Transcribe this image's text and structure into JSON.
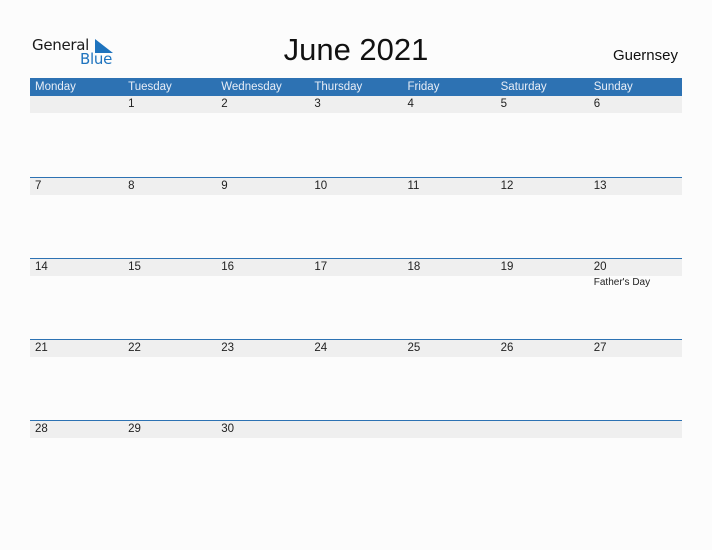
{
  "brand": {
    "line1": "General",
    "line2": "Blue",
    "color": "#1e73be"
  },
  "title": "June 2021",
  "country": "Guernsey",
  "accent_color": "#2d72b3",
  "weekdays": [
    "Monday",
    "Tuesday",
    "Wednesday",
    "Thursday",
    "Friday",
    "Saturday",
    "Sunday"
  ],
  "weeks": [
    {
      "days": [
        "",
        "1",
        "2",
        "3",
        "4",
        "5",
        "6"
      ],
      "events": [
        "",
        "",
        "",
        "",
        "",
        "",
        ""
      ]
    },
    {
      "days": [
        "7",
        "8",
        "9",
        "10",
        "11",
        "12",
        "13"
      ],
      "events": [
        "",
        "",
        "",
        "",
        "",
        "",
        ""
      ]
    },
    {
      "days": [
        "14",
        "15",
        "16",
        "17",
        "18",
        "19",
        "20"
      ],
      "events": [
        "",
        "",
        "",
        "",
        "",
        "",
        "Father's Day"
      ]
    },
    {
      "days": [
        "21",
        "22",
        "23",
        "24",
        "25",
        "26",
        "27"
      ],
      "events": [
        "",
        "",
        "",
        "",
        "",
        "",
        ""
      ]
    },
    {
      "days": [
        "28",
        "29",
        "30",
        "",
        "",
        "",
        ""
      ],
      "events": [
        "",
        "",
        "",
        "",
        "",
        "",
        ""
      ]
    }
  ]
}
